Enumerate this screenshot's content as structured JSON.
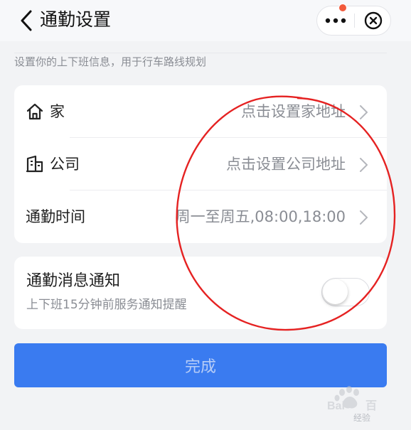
{
  "header": {
    "title": "通勤设置",
    "back_icon": "chevron-left-icon",
    "more_icon": "more-dots-icon",
    "close_icon": "close-circle-icon"
  },
  "hint": "设置你的上下班信息，用于行车路线规划",
  "rows": [
    {
      "icon": "home-icon",
      "label": "家",
      "value": "点击设置家地址"
    },
    {
      "icon": "building-icon",
      "label": "公司",
      "value": "点击设置公司地址"
    },
    {
      "icon": "",
      "label": "通勤时间",
      "value": "周一至周五,08:00,18:00"
    }
  ],
  "notification": {
    "title": "通勤消息通知",
    "subtitle": "上下班15分钟前服务通知提醒",
    "enabled": false
  },
  "done_button": "完成",
  "watermark": {
    "logo": "Baidu",
    "text": "经验"
  },
  "colors": {
    "primary": "#3a7bf0",
    "annotation": "#e52222",
    "badge": "#f25a3b"
  }
}
